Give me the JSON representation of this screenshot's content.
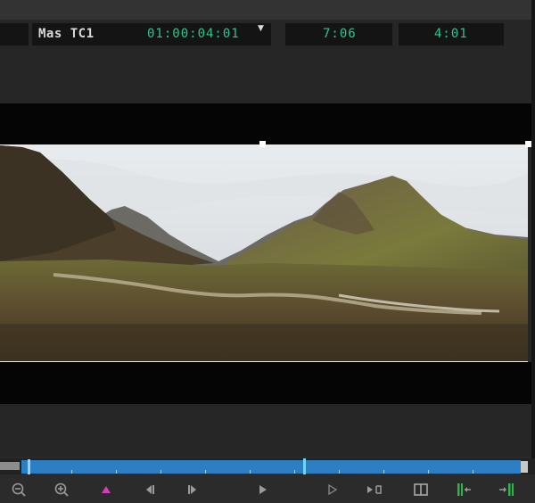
{
  "timecode_bar": {
    "source_label": "Mas TC1",
    "master_timecode": "01:00:04:01",
    "duration": "7:06",
    "position": "4:01"
  },
  "viewer": {
    "content": "landscape-frame"
  },
  "toolbar": {
    "icons": [
      "zoom-out-icon",
      "zoom-in-icon",
      "add-marker-icon",
      "step-back-icon",
      "step-forward-icon",
      "play-icon",
      "play-in-to-out-icon",
      "loop-icon",
      "compare-view-icon",
      "insert-icon",
      "overwrite-icon"
    ]
  },
  "colors": {
    "timecode_green": "#32c38a",
    "timeline_blue": "#2d7fc4",
    "playhead_cyan": "#6fd7ff",
    "marker_magenta": "#d23fb8",
    "edit_green": "#2fb54a"
  }
}
